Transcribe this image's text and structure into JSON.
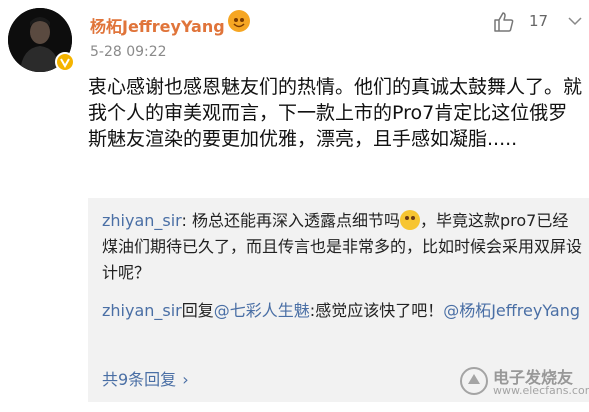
{
  "post": {
    "username": "杨柘JeffreyYang",
    "timestamp": "5-28 09:22",
    "like_count": "17",
    "body": "衷心感谢也感恩魅友们的热情。他们的真诚太鼓舞人了。就我个人的审美观而言，下一款上市的Pro7肯定比这位俄罗斯魅友渲染的要更加优雅，漂亮，且手感如凝脂....."
  },
  "replies": [
    {
      "user": "zhiyan_sir",
      "text_before_emoji": ": 杨总还能再深入透露点细节吗",
      "text_after_emoji": "，毕竟这款pro7已经煤油们期待已久了，而且传言也是非常多的，比如时候会采用双屏设计呢？"
    },
    {
      "user": "zhiyan_sir",
      "reply_word": "回复",
      "mention_1": "@七彩人生魅",
      "text_mid": ":感觉应该快了吧！",
      "mention_2": "@杨柘JeffreyYang"
    }
  ],
  "view_all": {
    "label": "共9条回复",
    "chevron": "›"
  },
  "watermark": {
    "brand": "电子发烧友",
    "url": "www.elecfans.com"
  },
  "icons": {
    "avatar": "avatar-photo",
    "verified": "verified-v-badge",
    "member": "vip-member-icon",
    "like": "thumbs-up-icon",
    "more": "chevron-down-icon"
  },
  "colors": {
    "username": "#e0743a",
    "link": "#4a6fa5",
    "reply_bg": "#f2f2f2"
  }
}
